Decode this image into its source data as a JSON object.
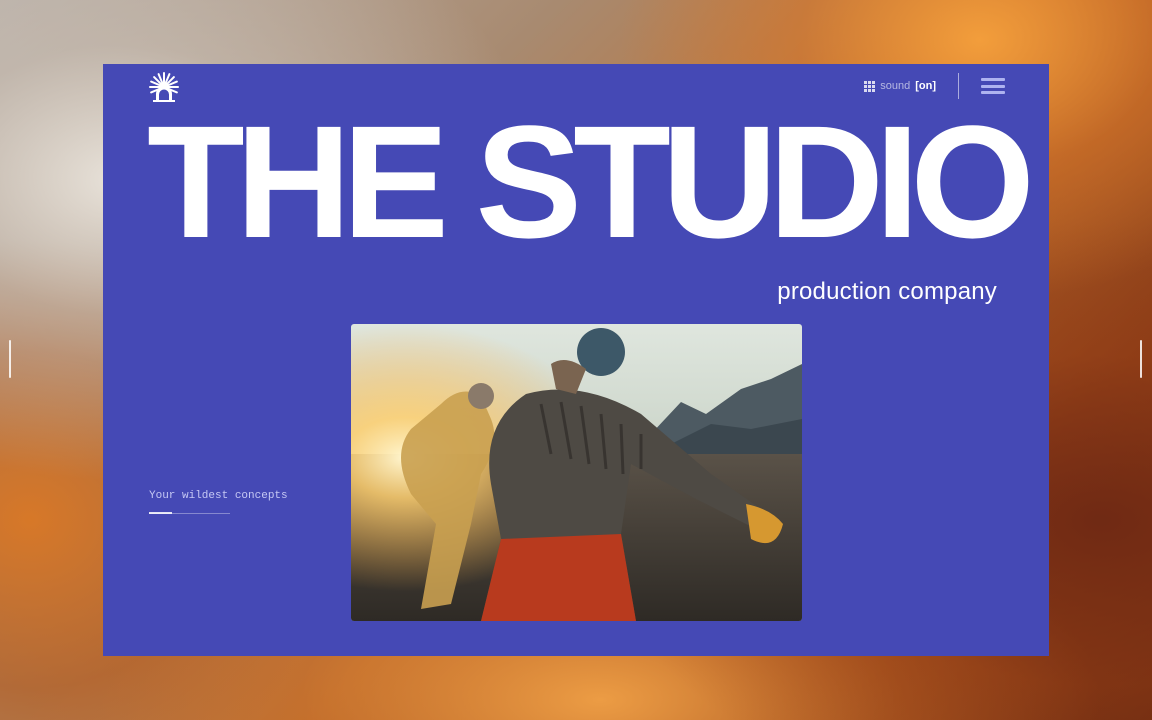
{
  "header": {
    "logo_name": "sunburst-logo",
    "sound_label": "sound",
    "sound_state": "[on]",
    "menu_icon": "hamburger-menu-icon"
  },
  "hero": {
    "headline": "THE STUDIO",
    "subtitle": "production company"
  },
  "tagline": {
    "text": "Your wildest concepts",
    "progress": 0.28
  },
  "media": {
    "description": "Two people running on a beach toward mountains at sunset"
  },
  "colors": {
    "card_background": "#4549b5",
    "text": "#ffffff",
    "menu_icon": "#aeb3f0"
  }
}
